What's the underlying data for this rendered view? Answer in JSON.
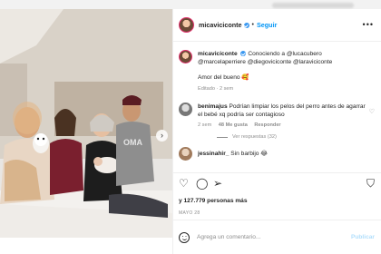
{
  "post": {
    "author": "micaviciconte",
    "follow_label": "Seguir",
    "separator": "•",
    "more_icon": "more-icon"
  },
  "caption": {
    "author": "micaviciconte",
    "text_line1": "Conociendo a @lucacubero",
    "text_line2": "@marcelaperriere @diegoviciconte @laraviciconte",
    "text2": "Amor del bueno 🥰",
    "meta": "Editado · 2 sem"
  },
  "comments": [
    {
      "user": "benimajus",
      "text": "Podrían limpiar los pelos del perro antes de agarrar el bebé xq podría ser contagioso",
      "time": "2 sem",
      "likes": "48 Me gusta",
      "reply": "Responder",
      "replies_label": "Ver respuestas (32)"
    },
    {
      "user": "jessinahir_",
      "text": "Sin barbijo 😂"
    }
  ],
  "likes": "y 127.779 personas más",
  "date": "MAYO 28",
  "add_comment": {
    "placeholder": "Agrega un comentario...",
    "publish_label": "Publicar"
  },
  "colors": {
    "accent": "#0095f6",
    "verified": "#3897f0",
    "muted": "#8e8e8e",
    "text": "#262626"
  }
}
